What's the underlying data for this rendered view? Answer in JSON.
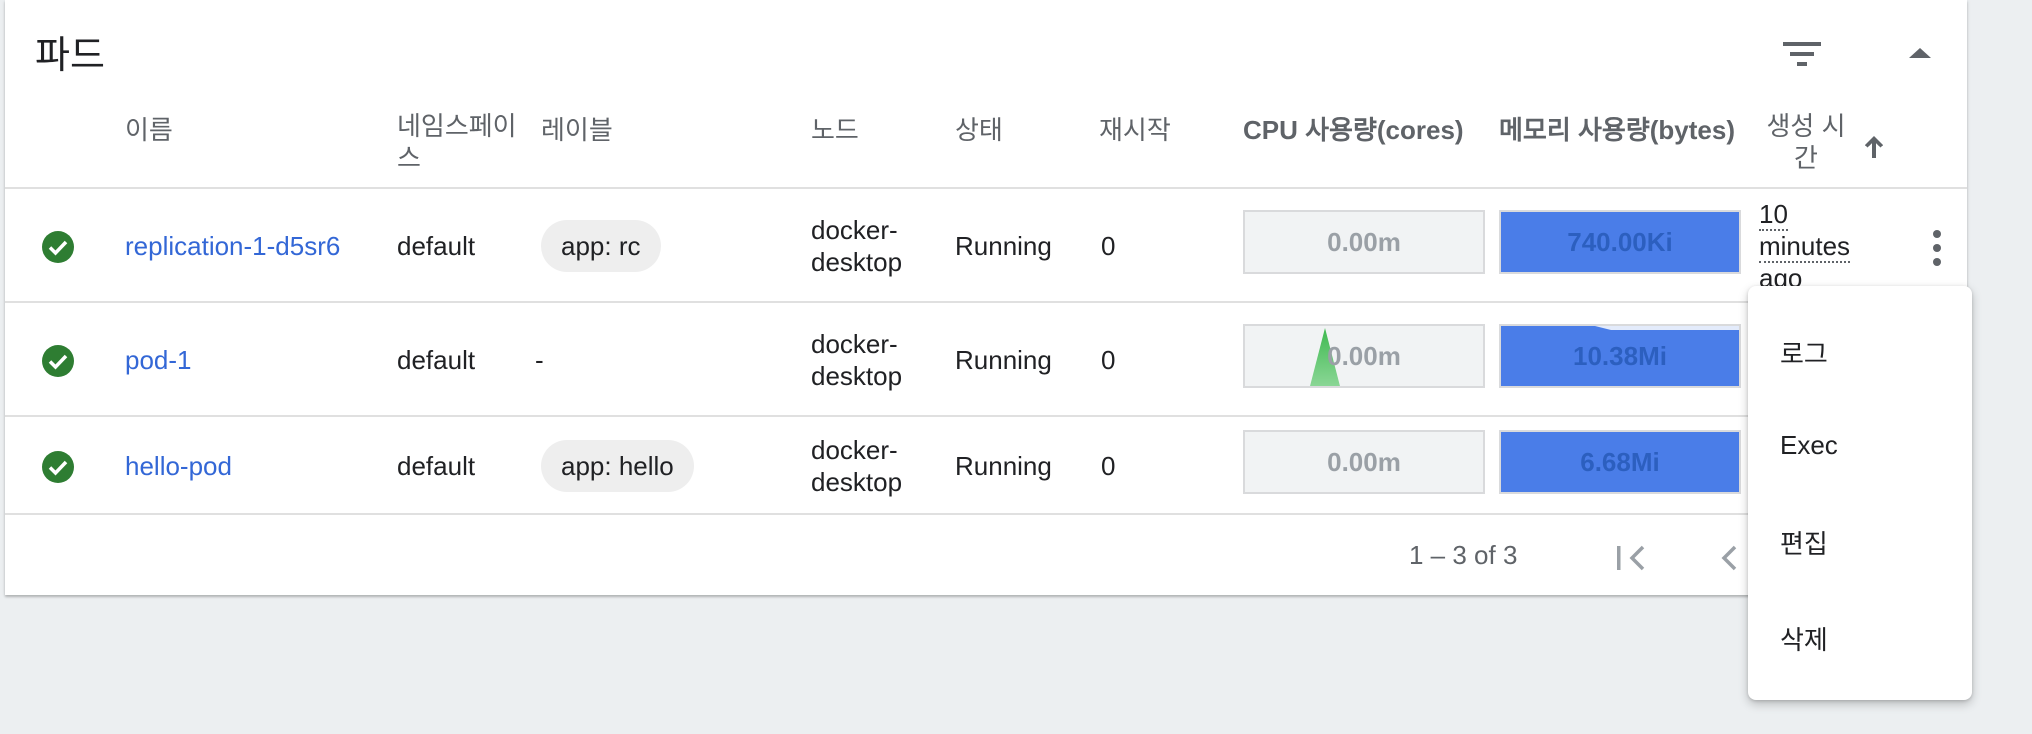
{
  "panel": {
    "title": "파드"
  },
  "columns": {
    "name": "이름",
    "namespace_l1": "네임스페이",
    "namespace_l2": "스",
    "labels": "레이블",
    "node": "노드",
    "status": "상태",
    "restarts": "재시작",
    "cpu": "CPU 사용량(cores)",
    "memory": "메모리 사용량(bytes)",
    "created_l1": "생성 시",
    "created_l2": "간"
  },
  "rows": [
    {
      "name": "replication-1-d5sr6",
      "namespace": "default",
      "label": "app: rc",
      "node_l1": "docker-",
      "node_l2": "desktop",
      "status": "Running",
      "restarts": "0",
      "cpu": "0.00m",
      "memory": "740.00Ki"
    },
    {
      "name": "pod-1",
      "namespace": "default",
      "label": "-",
      "node_l1": "docker-",
      "node_l2": "desktop",
      "status": "Running",
      "restarts": "0",
      "cpu": "0.00m",
      "memory": "10.38Mi"
    },
    {
      "name": "hello-pod",
      "namespace": "default",
      "label": "app: hello",
      "node_l1": "docker-",
      "node_l2": "desktop",
      "status": "Running",
      "restarts": "0",
      "cpu": "0.00m",
      "memory": "6.68Mi"
    }
  ],
  "created_first": {
    "l1": "10",
    "l2": "minutes",
    "l3": "ago"
  },
  "pagination": {
    "range": "1 – 3 of 3"
  },
  "context_menu": {
    "logs": "로그",
    "exec": "Exec",
    "edit": "편집",
    "delete": "삭제"
  },
  "colors": {
    "ok": "#2e7d32",
    "link": "#3367d6",
    "memory": "#4a7de8",
    "cpu_spike": "#57bb6a"
  },
  "icons": [
    "filter-icon",
    "collapse-icon",
    "sort-arrow-up-icon",
    "check-circle-icon",
    "more-vert-icon",
    "first-page-icon",
    "prev-page-icon"
  ]
}
